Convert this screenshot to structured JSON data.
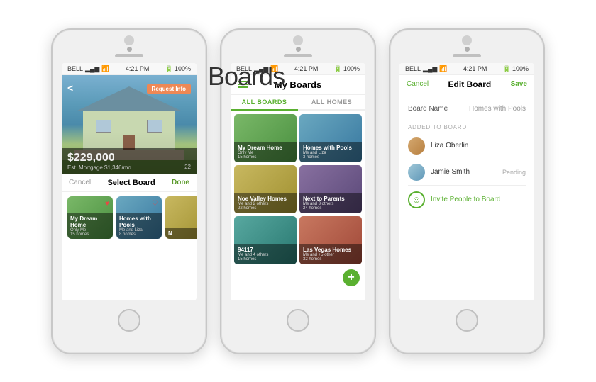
{
  "title": "Boards",
  "phone1": {
    "carrier": "BELL",
    "time": "4:21 PM",
    "battery": "100%",
    "price": "$229,000",
    "mortgage": "Est. Mortgage $1,346/mo",
    "photo_count": "22",
    "request_info": "Request Info",
    "back": "<",
    "bar_cancel": "Cancel",
    "bar_title": "Select Board",
    "bar_done": "Done",
    "boards": [
      {
        "title": "My Dream Home",
        "sub": "Only Me",
        "sub2": "15 homes",
        "color": "green"
      },
      {
        "title": "Homes with Pools",
        "sub": "Me and Liza",
        "sub2": "8 homes",
        "color": "blue"
      },
      {
        "title": "N",
        "sub": "M",
        "sub2": "",
        "color": "yellow"
      }
    ]
  },
  "phone2": {
    "carrier": "BELL",
    "time": "4:21 PM",
    "battery": "100%",
    "title": "My Boards",
    "tab_all_boards": "ALL BOARDS",
    "tab_all_homes": "ALL HOMES",
    "boards": [
      {
        "title": "My Dream Home",
        "sub": "Only Me",
        "sub2": "15 homes",
        "color": "green"
      },
      {
        "title": "Homes with Pools",
        "sub": "Me and Liza",
        "sub2": "3 homes",
        "color": "blue"
      },
      {
        "title": "Noe Valley Homes",
        "sub": "Me and 2 others",
        "sub2": "22 homes",
        "color": "yellow"
      },
      {
        "title": "Next to Parents",
        "sub": "Me and 3 others",
        "sub2": "24 homes",
        "color": "purple"
      },
      {
        "title": "94117",
        "sub": "Me and 4 others",
        "sub2": "15 homes",
        "color": "teal"
      },
      {
        "title": "Las Vegas Homes",
        "sub": "Me and +5 other",
        "sub2": "32 homes",
        "color": "red"
      }
    ]
  },
  "phone3": {
    "carrier": "BELL",
    "time": "4:21 PM",
    "battery": "100%",
    "cancel": "Cancel",
    "title": "Edit Board",
    "save": "Save",
    "field_label": "Board Name",
    "field_value": "Homes with Pools",
    "section_label": "ADDED TO BOARD",
    "members": [
      {
        "name": "Liza Oberlin",
        "status": "",
        "avatar": "liza"
      },
      {
        "name": "Jamie Smith",
        "status": "Pending",
        "avatar": "jamie"
      }
    ],
    "invite_label": "Invite People to Board"
  }
}
